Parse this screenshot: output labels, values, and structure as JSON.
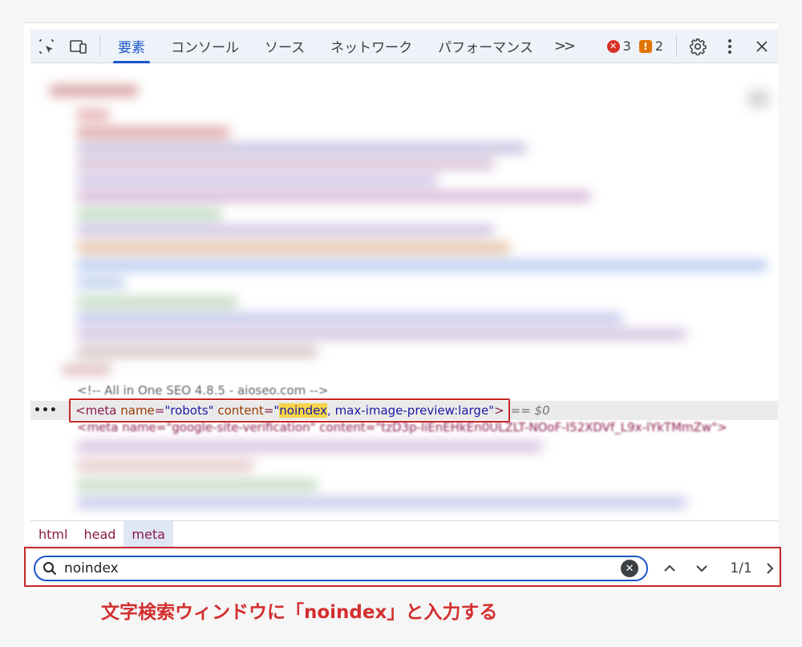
{
  "toolbar": {
    "tabs": [
      {
        "label": "要素",
        "active": true
      },
      {
        "label": "コンソール"
      },
      {
        "label": "ソース"
      },
      {
        "label": "ネットワーク"
      },
      {
        "label": "パフォーマンス"
      }
    ],
    "more_label": ">>",
    "error_count": "3",
    "warning_count": "2"
  },
  "code": {
    "comment_line": "<!-- All in One SEO 4.8.5 - aioseo.com -->",
    "selected_line": {
      "open": "<meta ",
      "name_attr": "name",
      "name_value": "\"robots\"",
      "content_attr": "content",
      "content_quote_open": "\"",
      "highlight": "noindex",
      "content_rest": ", max-image-preview:large\"",
      "close": ">",
      "eq": "== $0",
      "dots": "•••"
    },
    "next_line": "<meta name=\"google-site-verification\" content=\"tzD3p-liEnEHkEn0ULZLT-NOoF-I52XDVf_L9x-lYkTMmZw\">"
  },
  "breadcrumbs": [
    "html",
    "head",
    "meta"
  ],
  "search": {
    "value": "noindex",
    "match_count": "1/1"
  },
  "caption": "文字検索ウィンドウに「noindex」と入力する",
  "colors": {
    "accent": "#1a56c9",
    "annotation_red": "#c62828",
    "highlight": "#f6d54a"
  }
}
